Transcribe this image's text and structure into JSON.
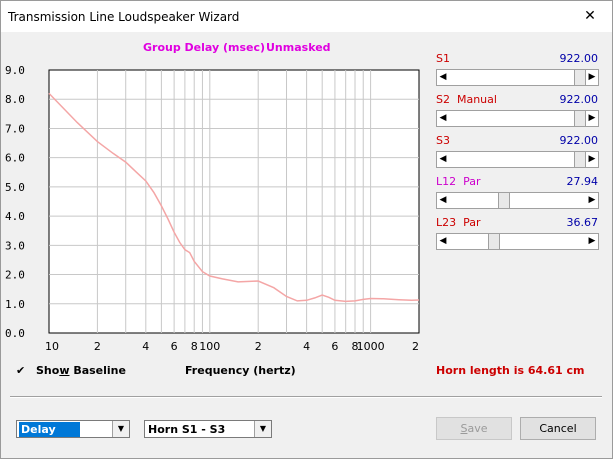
{
  "window": {
    "title": "Transmission Line Loudspeaker Wizard",
    "close_glyph": "✕"
  },
  "graph": {
    "title": "Group Delay (msec)",
    "mask_status": "Unmasked",
    "xlabel": "Frequency (hertz)",
    "y_ticks": [
      "9.0",
      "8.0",
      "7.0",
      "6.0",
      "5.0",
      "4.0",
      "3.0",
      "2.0",
      "1.0",
      "0.0"
    ],
    "x_ticks": [
      "10",
      "2",
      "4",
      "6",
      "8",
      "100",
      "2",
      "4",
      "6",
      "8",
      "1000",
      "2"
    ],
    "colors": {
      "curve": "#f4a6a6",
      "grid": "#c8c8c8",
      "title": "#e000e0"
    }
  },
  "chart_data": {
    "type": "line",
    "title": "Group Delay (msec)",
    "xlabel": "Frequency (hertz)",
    "ylabel": "",
    "x_scale": "log",
    "xlim": [
      10,
      2000
    ],
    "ylim": [
      0,
      9
    ],
    "grid": true,
    "series": [
      {
        "x": [
          10,
          12,
          15,
          20,
          25,
          30,
          35,
          40,
          45,
          50,
          55,
          60,
          65,
          70,
          75,
          80,
          90,
          100,
          120,
          150,
          200,
          250,
          300,
          350,
          400,
          450,
          500,
          550,
          600,
          700,
          800,
          900,
          1000,
          1200,
          1500,
          1800,
          2000
        ],
        "y": [
          8.2,
          7.75,
          7.2,
          6.55,
          6.15,
          5.85,
          5.5,
          5.2,
          4.8,
          4.35,
          3.9,
          3.45,
          3.1,
          2.85,
          2.75,
          2.45,
          2.1,
          1.95,
          1.85,
          1.75,
          1.78,
          1.55,
          1.25,
          1.1,
          1.12,
          1.2,
          1.3,
          1.22,
          1.12,
          1.08,
          1.1,
          1.15,
          1.18,
          1.17,
          1.14,
          1.12,
          1.13
        ]
      }
    ]
  },
  "sliders": [
    {
      "label": "S1",
      "value": "922.00",
      "position": 1.0,
      "color": "#cc0000"
    },
    {
      "label": "S2  Manual",
      "value": "922.00",
      "position": 1.0,
      "color": "#cc0000"
    },
    {
      "label": "S3",
      "value": "922.00",
      "position": 1.0,
      "color": "#cc0000"
    },
    {
      "label": "L12  Par",
      "value": "27.94",
      "position": 0.39,
      "color": "#cc00cc"
    },
    {
      "label": "L23  Par",
      "value": "36.67",
      "position": 0.31,
      "color": "#cc0000"
    }
  ],
  "checkbox": {
    "label_pre": "Sho",
    "label_u": "w",
    "label_post": " Baseline",
    "checked": true
  },
  "horn_length": "Horn length is 64.61 cm",
  "controls": {
    "plot_select": "Delay",
    "range_select": "Horn S1 - S3",
    "save_pre": "",
    "save_u": "S",
    "save_post": "ave",
    "cancel": "Cancel"
  }
}
